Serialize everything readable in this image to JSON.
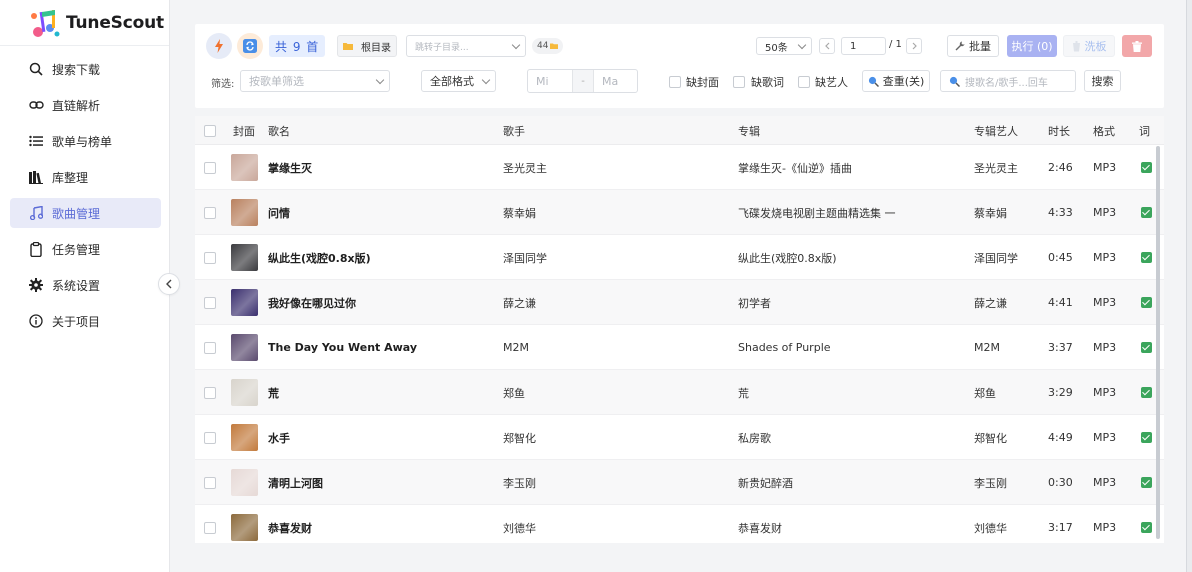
{
  "app": {
    "name": "TuneScout"
  },
  "sidebar": {
    "items": [
      {
        "label": "搜索下载",
        "icon": "search-icon"
      },
      {
        "label": "直链解析",
        "icon": "link-icon"
      },
      {
        "label": "歌单与榜单",
        "icon": "list-icon"
      },
      {
        "label": "库整理",
        "icon": "library-icon"
      },
      {
        "label": "歌曲管理",
        "icon": "music-note-icon",
        "active": true
      },
      {
        "label": "任务管理",
        "icon": "clipboard-icon"
      },
      {
        "label": "系统设置",
        "icon": "gear-icon"
      },
      {
        "label": "关于项目",
        "icon": "info-icon"
      }
    ]
  },
  "toolbar": {
    "count_label": "共 9 首",
    "root_dir_label": "根目录",
    "subdir_placeholder": "跳转子目录...",
    "folder_count": "44",
    "page_size": "50条",
    "page_current": "1",
    "page_total": "/ 1",
    "batch_label": "批量",
    "execute_label": "执行 (0)",
    "wash_label": "洗板"
  },
  "filters": {
    "label": "筛选:",
    "playlist_placeholder": "按歌单筛选",
    "format_value": "全部格式",
    "min_placeholder": "Mi",
    "range_sep": "-",
    "max_placeholder": "Ma",
    "missing_cover": "缺封面",
    "missing_lyrics": "缺歌词",
    "missing_artist": "缺艺人",
    "dedupe_label": "查重(关)",
    "search_placeholder": "搜歌名/歌手...回车",
    "search_button": "搜索"
  },
  "table": {
    "headers": [
      "封面",
      "歌名",
      "歌手",
      "专辑",
      "专辑艺人",
      "时长",
      "格式",
      "词"
    ],
    "rows": [
      {
        "title": "掌缘生灭",
        "artist": "圣光灵主",
        "album": "掌缘生灭-《仙逆》插曲",
        "album_artist": "圣光灵主",
        "duration": "2:46",
        "format": "MP3",
        "cover_color": "#c9a79a",
        "has_lyrics": true
      },
      {
        "title": "问情",
        "artist": "蔡幸娟",
        "album": "飞碟发烧电视剧主题曲精选集 一",
        "album_artist": "蔡幸娟",
        "duration": "4:33",
        "format": "MP3",
        "cover_color": "#b9815f",
        "has_lyrics": true
      },
      {
        "title": "纵此生(戏腔0.8x版)",
        "artist": "泽国同学",
        "album": "纵此生(戏腔0.8x版)",
        "album_artist": "泽国同学",
        "duration": "0:45",
        "format": "MP3",
        "cover_color": "#3a3a3e",
        "has_lyrics": true
      },
      {
        "title": "我好像在哪见过你",
        "artist": "薛之谦",
        "album": "初学者",
        "album_artist": "薛之谦",
        "duration": "4:41",
        "format": "MP3",
        "cover_color": "#3a2f6e",
        "has_lyrics": true
      },
      {
        "title": "The Day You Went Away",
        "artist": "M2M",
        "album": "Shades of Purple",
        "album_artist": "M2M",
        "duration": "3:37",
        "format": "MP3",
        "cover_color": "#5a4a6e",
        "has_lyrics": true
      },
      {
        "title": "荒",
        "artist": "郑鱼",
        "album": "荒",
        "album_artist": "郑鱼",
        "duration": "3:29",
        "format": "MP3",
        "cover_color": "#d8d4cc",
        "has_lyrics": true
      },
      {
        "title": "水手",
        "artist": "郑智化",
        "album": "私房歌",
        "album_artist": "郑智化",
        "duration": "4:49",
        "format": "MP3",
        "cover_color": "#c27a3c",
        "has_lyrics": true
      },
      {
        "title": "清明上河图",
        "artist": "李玉刚",
        "album": "新贵妃醉酒",
        "album_artist": "李玉刚",
        "duration": "0:30",
        "format": "MP3",
        "cover_color": "#e6d9d6",
        "has_lyrics": true
      },
      {
        "title": "恭喜发财",
        "artist": "刘德华",
        "album": "恭喜发财",
        "album_artist": "刘德华",
        "duration": "3:17",
        "format": "MP3",
        "cover_color": "#8c6a3c",
        "has_lyrics": true
      }
    ]
  }
}
